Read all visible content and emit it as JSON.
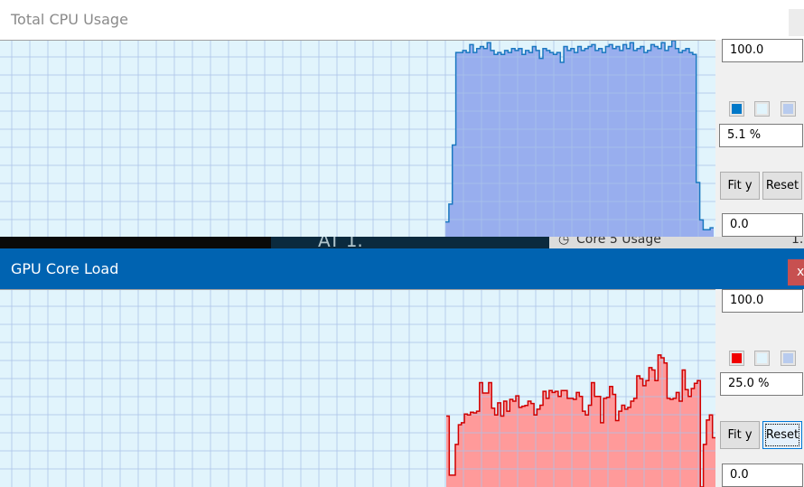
{
  "cpu_window": {
    "title": "Total CPU Usage",
    "max_value": "100.0",
    "min_value": "0.0",
    "current_value": "5.1 %",
    "fit_y_label": "Fit y",
    "reset_label": "Reset",
    "colors": {
      "line": "#1a78c0",
      "fill": "#98aeee",
      "background": "#e1f4fc",
      "grid": "#a9c1e8"
    }
  },
  "background_window": {
    "partial_text": "AT 1.",
    "sensor_label": "Core 5 Usage",
    "sensor_value": "1."
  },
  "gpu_window": {
    "title": "GPU Core Load",
    "close_label": "x",
    "max_value": "100.0",
    "min_value": "0.0",
    "current_value": "25.0 %",
    "fit_y_label": "Fit y",
    "reset_label": "Reset",
    "colors": {
      "line": "#d00000",
      "fill": "#ff9a9a",
      "background": "#e1f4fc",
      "grid": "#a9c1e8"
    }
  },
  "chart_data": [
    {
      "type": "area",
      "title": "Total CPU Usage",
      "ylim": [
        0,
        100
      ],
      "grid": true,
      "values": [
        8,
        17,
        47,
        94,
        94,
        95,
        94,
        98,
        94,
        96,
        97,
        96,
        99,
        95,
        93,
        94,
        93,
        95,
        94,
        96,
        95,
        96,
        93,
        95,
        94,
        97,
        95,
        91,
        96,
        95,
        94,
        93,
        94,
        89,
        97,
        95,
        96,
        94,
        97,
        95,
        96,
        97,
        98,
        95,
        96,
        94,
        97,
        98,
        96,
        97,
        95,
        98,
        96,
        99,
        95,
        96,
        97,
        94,
        95,
        98,
        97,
        96,
        99,
        95,
        97,
        100,
        96,
        94,
        95,
        96,
        94,
        93,
        28,
        9,
        4,
        4,
        5
      ]
    },
    {
      "type": "area",
      "title": "GPU Core Load",
      "ylim": [
        0,
        100
      ],
      "grid": true,
      "values": [
        36,
        6,
        6,
        21.6,
        31.6,
        32.6,
        37,
        36.6,
        38,
        37.6,
        38.5,
        53,
        47.7,
        47.7,
        53,
        40,
        36.6,
        42.7,
        36,
        43.6,
        38.5,
        44.5,
        43.6,
        46.3,
        40.4,
        41,
        41.4,
        43.6,
        42.4,
        36.6,
        39.5,
        41.5,
        48.6,
        45,
        49,
        48,
        48.6,
        46,
        49,
        49,
        45,
        45,
        44.5,
        48,
        46,
        38.5,
        36.6,
        41.5,
        53,
        46,
        46,
        32.6,
        45,
        45.5,
        51,
        47,
        33.7,
        38.5,
        41.5,
        39.5,
        40.4,
        43.6,
        45,
        56.4,
        55,
        51.4,
        54,
        60.6,
        59.4,
        54,
        67,
        65.6,
        63,
        45,
        44.5,
        45,
        48,
        43.6,
        59.4,
        49.4,
        46,
        50,
        52.6,
        54,
        0,
        21.6,
        34,
        36.6,
        25
      ]
    }
  ]
}
